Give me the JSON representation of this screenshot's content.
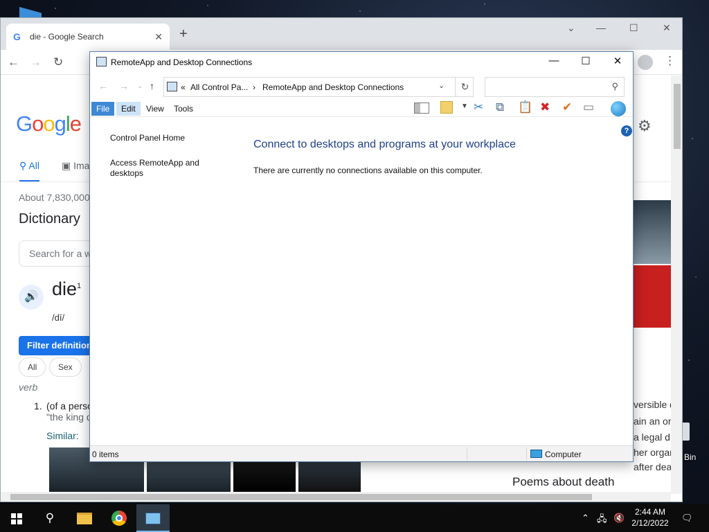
{
  "chrome": {
    "tab_title": "die - Google Search",
    "tab_close": "✕",
    "new_tab": "+",
    "controls": {
      "restore_down": "⌄",
      "minimize": "—",
      "maximize": "☐",
      "close": "✕"
    },
    "nav": {
      "back": "←",
      "forward": "→",
      "reload": "↻"
    },
    "more": "⋮"
  },
  "google": {
    "logo": {
      "l1": "G",
      "l2": "o",
      "l3": "o",
      "l4": "g",
      "l5": "l",
      "l6": "e"
    },
    "tab_all": "All",
    "tab_images": "Ima",
    "result_stats": "About 7,830,000",
    "dictionary_title": "Dictionary",
    "dictionary_search_placeholder": "Search for a w",
    "word": "die",
    "word_superscript": "1",
    "phonetic": "/dī/",
    "filter_button": "Filter definitions",
    "chips": [
      "All",
      "Sex"
    ],
    "part_of_speech": "verb",
    "definition_number": "1.",
    "definition_text": "(of a perso",
    "definition_example": "\"the king d",
    "similar_label": "Similar:",
    "side_snippets": [
      "versible d",
      "ain an or",
      "a legal d",
      "her organ",
      "after dea"
    ],
    "poems_heading": "Poems about death"
  },
  "control_panel": {
    "window_title": "RemoteApp and Desktop Connections",
    "window_controls": {
      "minimize": "—",
      "maximize": "☐",
      "close": "✕"
    },
    "breadcrumb_prefix": "«",
    "breadcrumb_parent": "All Control Pa...",
    "breadcrumb_separator": "›",
    "breadcrumb_current": "RemoteApp and Desktop Connections",
    "nav": {
      "back": "←",
      "forward": "→",
      "recent": "⌄",
      "up": "↑",
      "dropdown": "⌄",
      "refresh": "↻",
      "search": "⚲"
    },
    "search_placeholder": "",
    "menu": {
      "file": "File",
      "edit": "Edit",
      "view": "View",
      "tools": "Tools"
    },
    "toolbar_icons": {
      "cut": "✂",
      "copy": "⧉",
      "paste": "📋",
      "delete": "✖",
      "check": "✔",
      "rename": "▭"
    },
    "help": "?",
    "left_links": [
      "Control Panel Home",
      "Access RemoteApp and",
      "desktops"
    ],
    "heading": "Connect to desktops and programs at your workplace",
    "message": "There are currently no connections available on this computer.",
    "status_items": "0 items",
    "status_location": "Computer"
  },
  "desktop": {
    "recycle_bin_label": "Bin"
  },
  "taskbar": {
    "search_glyph": "⚲",
    "tray": {
      "chevron": "⌃",
      "network": "🖧",
      "volume": "🔇",
      "notifications": "🗨"
    },
    "time": "2:44 AM",
    "date": "2/12/2022"
  }
}
